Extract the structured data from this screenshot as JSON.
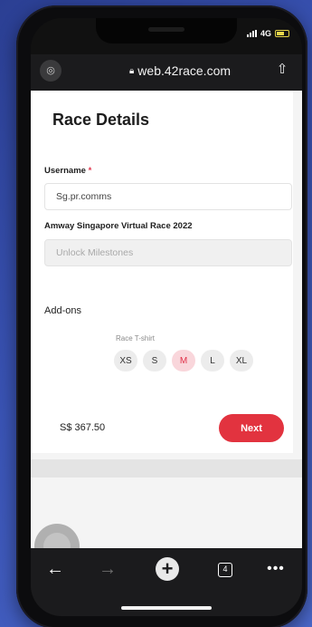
{
  "status": {
    "network": "4G"
  },
  "browser": {
    "url": "web.42race.com"
  },
  "form": {
    "title": "Race Details",
    "username_label": "Username",
    "required_mark": "*",
    "username_value": "Sg.pr.comms",
    "race_label": "Amway Singapore Virtual Race 2022",
    "milestones_placeholder": "Unlock Milestones",
    "addons_label": "Add-ons",
    "tshirt_label": "Race T-shirt",
    "sizes": [
      "XS",
      "S",
      "M",
      "L",
      "XL"
    ],
    "selected_size": "M",
    "price": "S$ 367.50",
    "next_label": "Next"
  },
  "toolbar": {
    "tab_count": "4"
  },
  "colors": {
    "accent": "#e2333f",
    "selected_size_bg": "#f9d6db"
  }
}
